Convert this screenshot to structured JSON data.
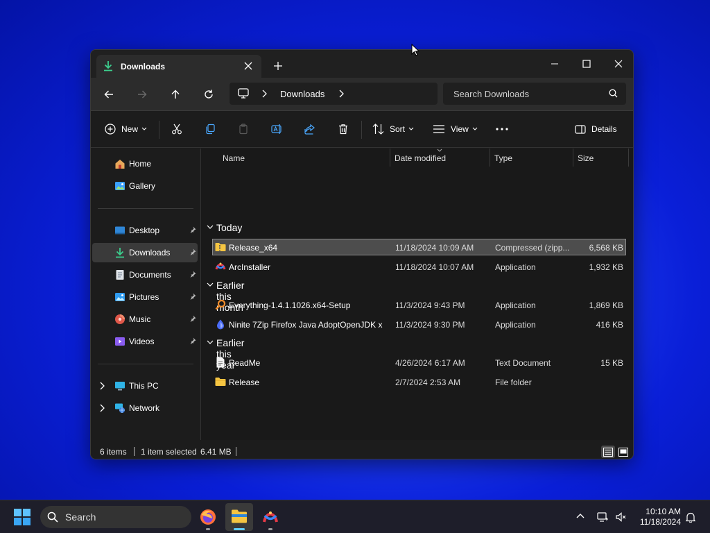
{
  "window": {
    "tab_title": "Downloads",
    "new_tab": "+",
    "address": {
      "crumb": "Downloads"
    },
    "search_placeholder": "Search Downloads"
  },
  "toolbar": {
    "new_label": "New",
    "sort_label": "Sort",
    "view_label": "View",
    "details_label": "Details"
  },
  "sidebar": {
    "quick": [
      {
        "label": "Home",
        "icon": "home-icon"
      },
      {
        "label": "Gallery",
        "icon": "gallery-icon"
      }
    ],
    "pinned": [
      {
        "label": "Desktop",
        "icon": "desktop-icon"
      },
      {
        "label": "Downloads",
        "icon": "downloads-icon"
      },
      {
        "label": "Documents",
        "icon": "documents-icon"
      },
      {
        "label": "Pictures",
        "icon": "pictures-icon"
      },
      {
        "label": "Music",
        "icon": "music-icon"
      },
      {
        "label": "Videos",
        "icon": "videos-icon"
      }
    ],
    "locations": [
      {
        "label": "This PC",
        "icon": "this-pc-icon"
      },
      {
        "label": "Network",
        "icon": "network-icon"
      }
    ]
  },
  "columns": {
    "name": "Name",
    "date": "Date modified",
    "type": "Type",
    "size": "Size"
  },
  "groups": [
    {
      "label": "Today",
      "files": [
        {
          "name": "Release_x64",
          "date": "11/18/2024 10:09 AM",
          "type": "Compressed (zipp...",
          "size": "6,568 KB",
          "icon": "zip-folder-icon",
          "selected": true
        },
        {
          "name": "ArcInstaller",
          "date": "11/18/2024 10:07 AM",
          "type": "Application",
          "size": "1,932 KB",
          "icon": "arc-app-icon"
        }
      ]
    },
    {
      "label": "Earlier this month",
      "files": [
        {
          "name": "Everything-1.4.1.1026.x64-Setup",
          "date": "11/3/2024 9:43 PM",
          "type": "Application",
          "size": "1,869 KB",
          "icon": "everything-app-icon"
        },
        {
          "name": "Ninite 7Zip Firefox Java AdoptOpenJDK x...",
          "date": "11/3/2024 9:30 PM",
          "type": "Application",
          "size": "416 KB",
          "icon": "ninite-app-icon"
        }
      ]
    },
    {
      "label": "Earlier this year",
      "files": [
        {
          "name": "ReadMe",
          "date": "4/26/2024 6:17 AM",
          "type": "Text Document",
          "size": "15 KB",
          "icon": "text-file-icon"
        },
        {
          "name": "Release",
          "date": "2/7/2024 2:53 AM",
          "type": "File folder",
          "size": "",
          "icon": "folder-icon"
        }
      ]
    }
  ],
  "status": {
    "items": "6 items",
    "selected": "1 item selected",
    "size": "6.41 MB"
  },
  "taskbar": {
    "search_label": "Search",
    "time": "10:10 AM",
    "date": "11/18/2024"
  },
  "colors": {
    "accent": "#60cdff",
    "folder": "#f5c542",
    "download_green": "#3ccf8e"
  }
}
